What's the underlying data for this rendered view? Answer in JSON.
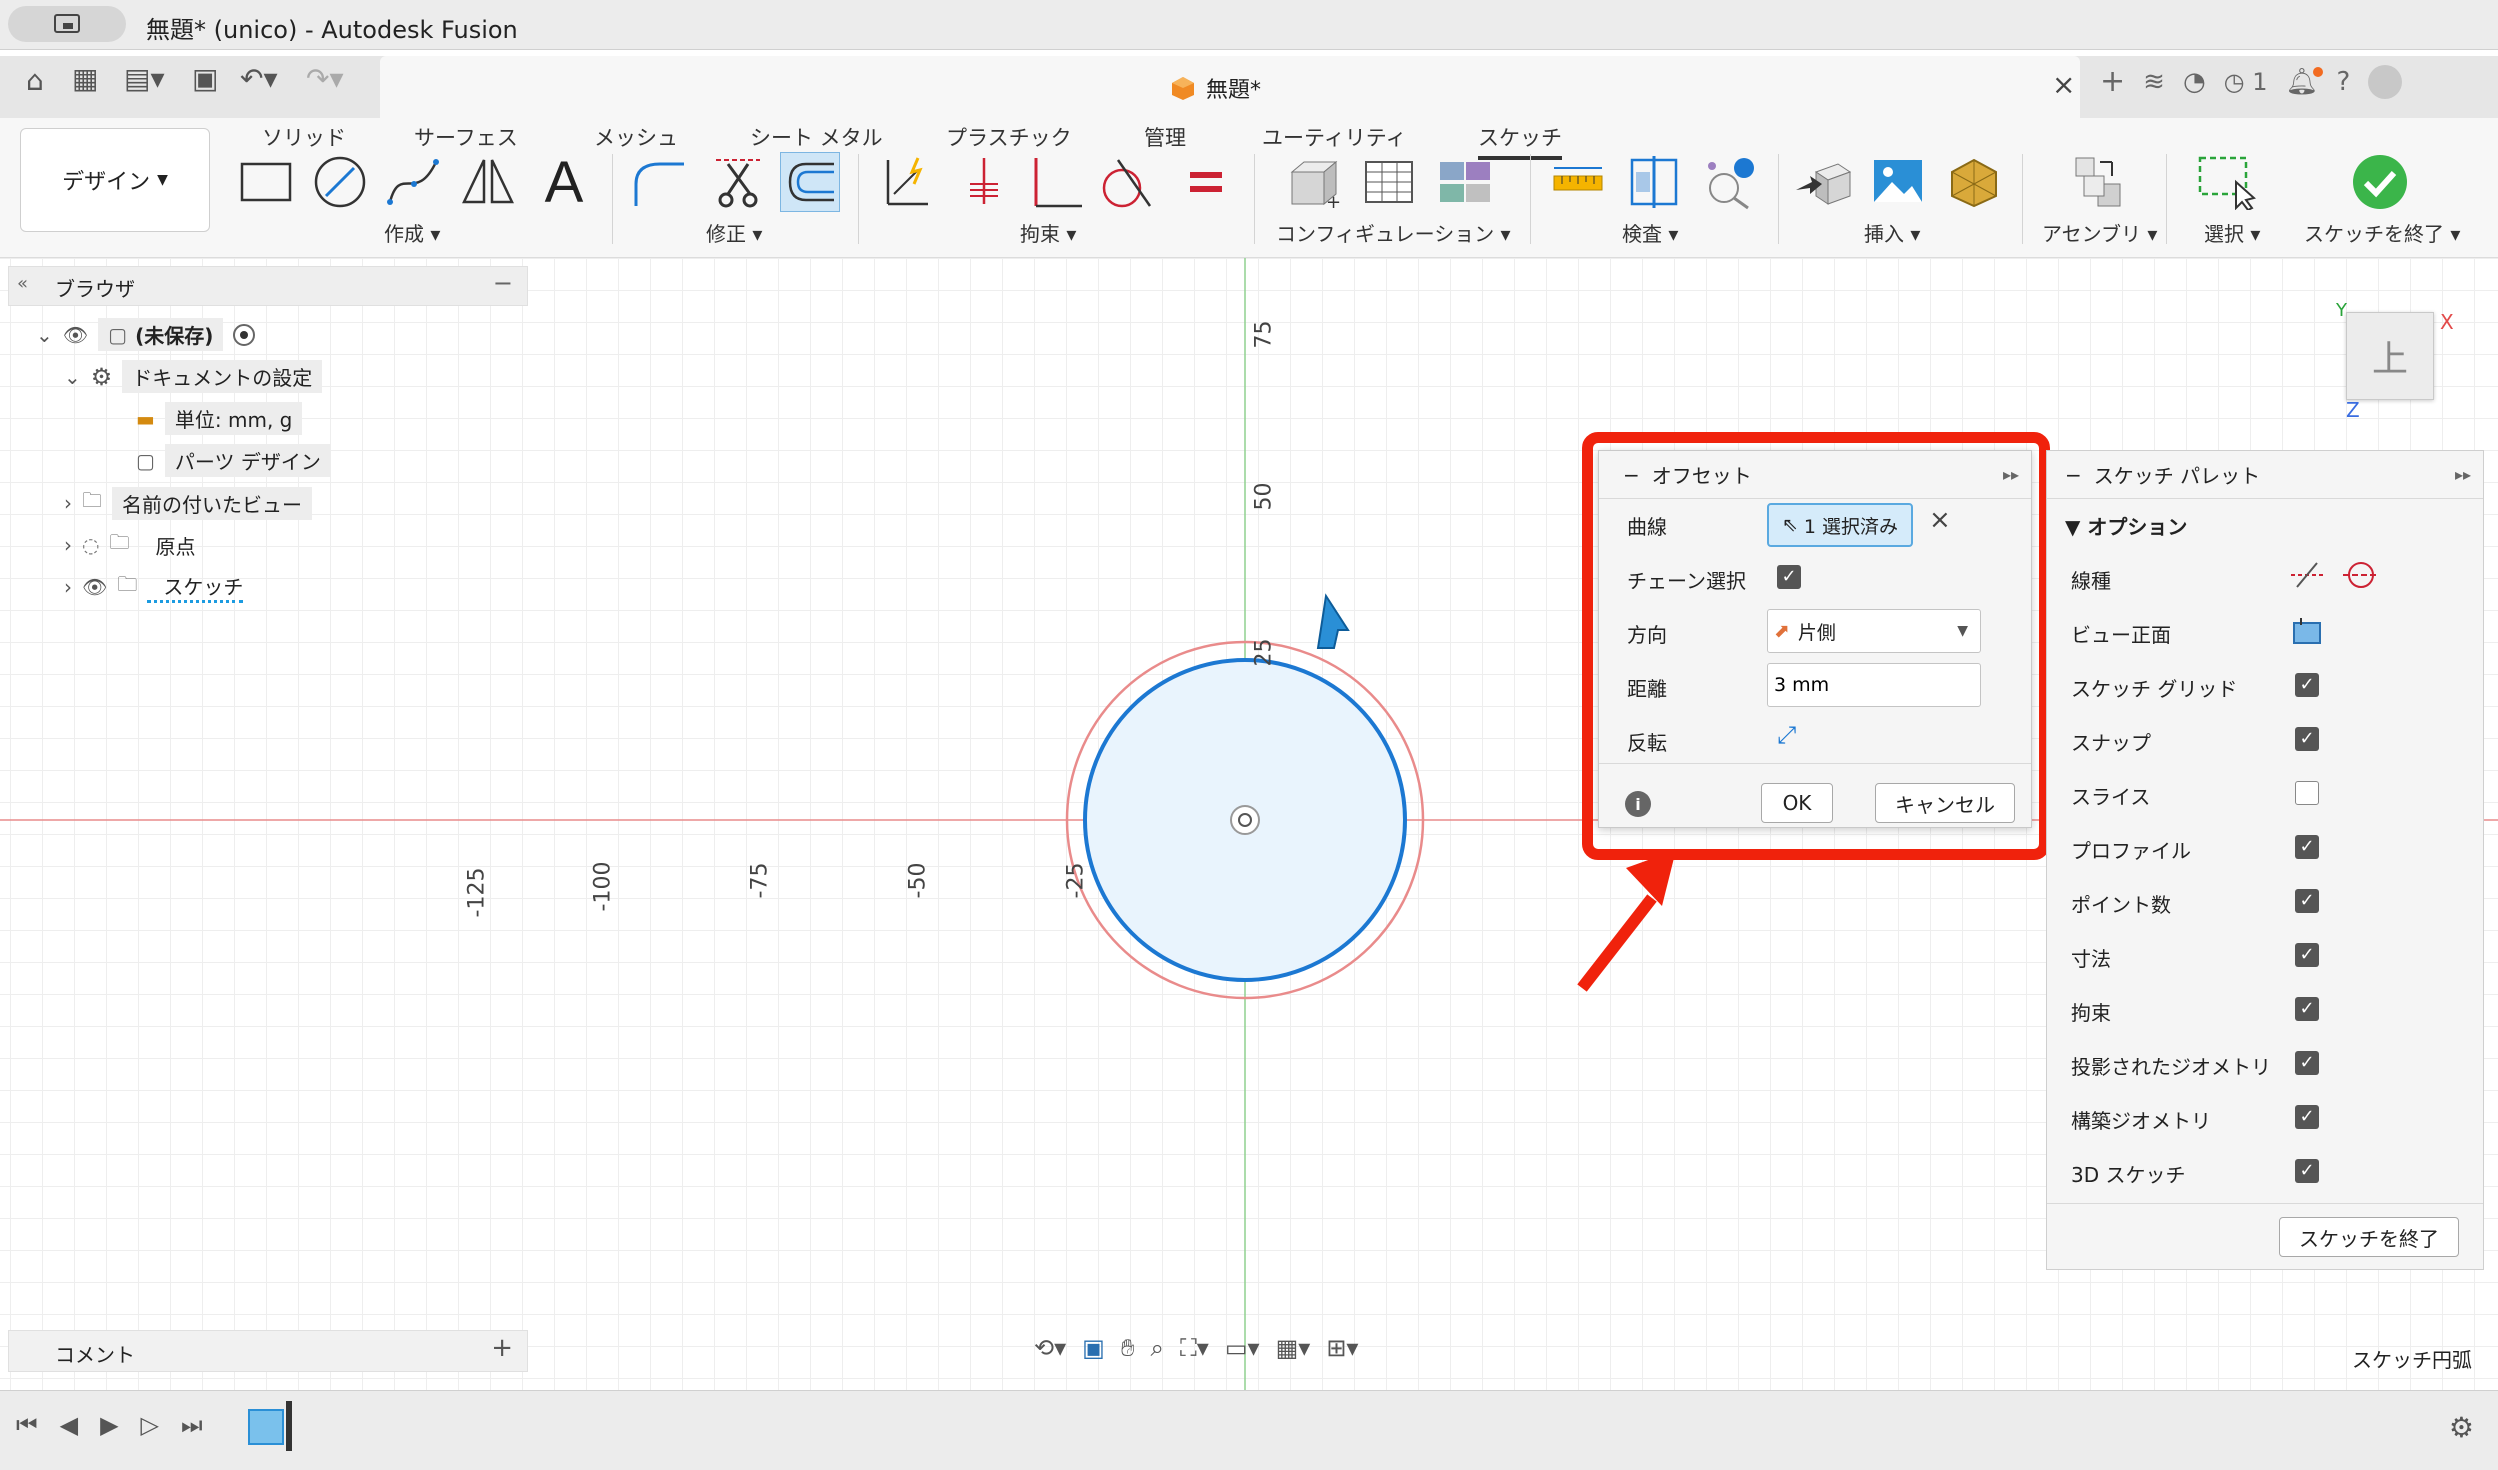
{
  "window": {
    "title": "無題* (unico) - Autodesk Fusion"
  },
  "document_tab": {
    "label": "無題*"
  },
  "header": {
    "job_count": "1"
  },
  "ribbon": {
    "workspace": "デザイン",
    "tabs": [
      "ソリッド",
      "サーフェス",
      "メッシュ",
      "シート メタル",
      "プラスチック",
      "管理",
      "ユーティリティ",
      "スケッチ"
    ],
    "groups": {
      "create": "作成",
      "modify": "修正",
      "constrain": "拘束",
      "configure": "コンフィギュレーション",
      "inspect": "検査",
      "insert": "挿入",
      "assemble": "アセンブリ",
      "select": "選択",
      "finish": "スケッチを終了"
    }
  },
  "browser": {
    "title": "ブラウザ",
    "root": "(未保存)",
    "doc_settings": "ドキュメントの設定",
    "units": "単位: mm, g",
    "part_design": "パーツ デザイン",
    "named_views": "名前の付いたビュー",
    "origin": "原点",
    "sketches": "スケッチ"
  },
  "canvas": {
    "axis_labels_x": [
      "-125",
      "-100",
      "-75",
      "-50",
      "-25"
    ],
    "axis_labels_y": [
      "75",
      "50",
      "25"
    ]
  },
  "viewcube": {
    "face": "上",
    "x": "X",
    "y": "Y",
    "z": "Z"
  },
  "offset_dialog": {
    "title": "オフセット",
    "curve_label": "曲線",
    "curve_value": "1 選択済み",
    "chain_label": "チェーン選択",
    "direction_label": "方向",
    "direction_value": "片側",
    "distance_label": "距離",
    "distance_value": "3 mm",
    "flip_label": "反転",
    "ok": "OK",
    "cancel": "キャンセル"
  },
  "sketch_palette": {
    "title": "スケッチ パレット",
    "section": "オプション",
    "items": [
      {
        "label": "線種"
      },
      {
        "label": "ビュー正面"
      },
      {
        "label": "スケッチ グリッド",
        "checked": true
      },
      {
        "label": "スナップ",
        "checked": true
      },
      {
        "label": "スライス",
        "checked": false
      },
      {
        "label": "プロファイル",
        "checked": true
      },
      {
        "label": "ポイント数",
        "checked": true
      },
      {
        "label": "寸法",
        "checked": true
      },
      {
        "label": "拘束",
        "checked": true
      },
      {
        "label": "投影されたジオメトリ",
        "checked": true
      },
      {
        "label": "構築ジオメトリ",
        "checked": true
      },
      {
        "label": "3D スケッチ",
        "checked": true
      }
    ],
    "finish_button": "スケッチを終了"
  },
  "comments": {
    "label": "コメント"
  },
  "status": {
    "text": "スケッチ円弧"
  },
  "colors": {
    "accent": "#0696d7",
    "highlight": "#f0220c",
    "sketch_circle": "#1c78d2",
    "offset_circle": "#e98b8b"
  }
}
